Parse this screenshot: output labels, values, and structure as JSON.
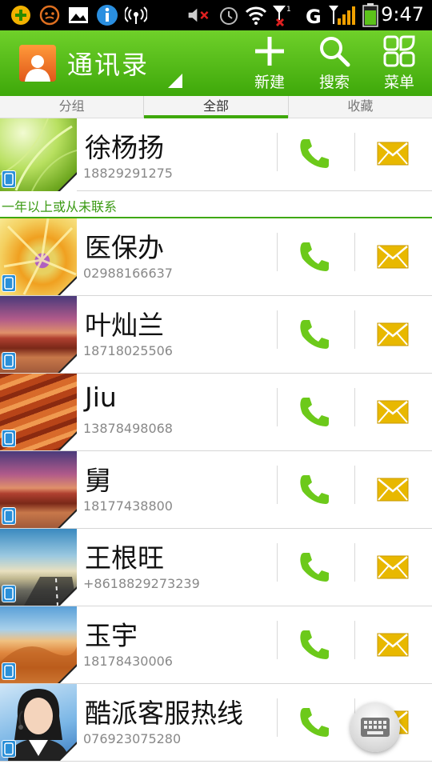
{
  "status_bar": {
    "time": "9:47",
    "icons": [
      "add-app-icon",
      "smiley-icon",
      "image-icon",
      "info-icon",
      "signal-broadcast-icon",
      "mute-icon",
      "alarm-icon",
      "wifi-icon",
      "no-signal-icon",
      "network-g-icon",
      "signal-bars-icon",
      "battery-icon"
    ]
  },
  "action_bar": {
    "title": "通讯录",
    "actions": [
      {
        "label": "新建",
        "icon": "plus-icon"
      },
      {
        "label": "搜索",
        "icon": "search-icon"
      },
      {
        "label": "菜单",
        "icon": "menu-grid-icon"
      }
    ]
  },
  "tabs": [
    {
      "label": "分组"
    },
    {
      "label": "全部"
    },
    {
      "label": "收藏"
    }
  ],
  "active_tab": "全部",
  "section_header": "一年以上或从未联系",
  "contacts": [
    {
      "name": "徐杨扬",
      "number": "18829291275",
      "photo": "green-leaves"
    },
    {
      "name": "医保办",
      "number": "02988166637",
      "photo": "purple-flower"
    },
    {
      "name": "叶灿兰",
      "number": "18718025506",
      "photo": "desert-sunset"
    },
    {
      "name": "Jiu",
      "number": "13878498068",
      "photo": "red-canyon"
    },
    {
      "name": "舅",
      "number": "18177438800",
      "photo": "desert-sunset"
    },
    {
      "name": "王根旺",
      "number": "+8618829273239",
      "photo": "road-sky"
    },
    {
      "name": "玉宇",
      "number": "18178430006",
      "photo": "sand-dunes"
    },
    {
      "name": "酷派客服热线",
      "number": "076923075280",
      "photo": "service-woman"
    }
  ],
  "colors": {
    "brand_green": "#3ea80a",
    "call_green": "#6cc91a",
    "mail_yellow": "#e8b800"
  }
}
